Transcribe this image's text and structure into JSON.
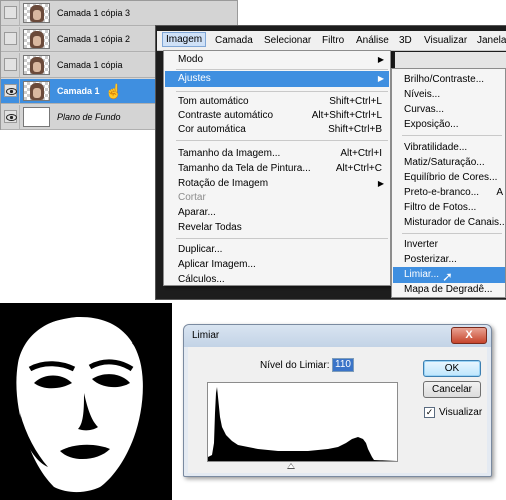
{
  "layers_panel": {
    "layers": [
      {
        "name": "Camada 1 cópia 3",
        "visible": false,
        "selected": false
      },
      {
        "name": "Camada 1 cópia 2",
        "visible": false,
        "selected": false
      },
      {
        "name": "Camada 1 cópia",
        "visible": false,
        "selected": false
      },
      {
        "name": "Camada 1",
        "visible": true,
        "selected": true
      },
      {
        "name": "Plano de Fundo",
        "visible": true,
        "selected": false
      }
    ]
  },
  "menubar": {
    "items": [
      "Imagem",
      "Camada",
      "Selecionar",
      "Filtro",
      "Análise",
      "3D",
      "Visualizar",
      "Janela"
    ],
    "active": "Imagem"
  },
  "image_menu": {
    "items": [
      {
        "label": "Modo",
        "shortcut": "",
        "submenu": true,
        "disabled": false
      },
      {
        "label": "Ajustes",
        "shortcut": "",
        "submenu": true,
        "disabled": false,
        "highlighted": true
      },
      {
        "label": "Tom automático",
        "shortcut": "Shift+Ctrl+L"
      },
      {
        "label": "Contraste automático",
        "shortcut": "Alt+Shift+Ctrl+L"
      },
      {
        "label": "Cor automática",
        "shortcut": "Shift+Ctrl+B"
      },
      {
        "label": "Tamanho da Imagem...",
        "shortcut": "Alt+Ctrl+I"
      },
      {
        "label": "Tamanho da Tela de Pintura...",
        "shortcut": "Alt+Ctrl+C"
      },
      {
        "label": "Rotação de Imagem",
        "shortcut": "",
        "submenu": true
      },
      {
        "label": "Cortar",
        "shortcut": "",
        "disabled": true
      },
      {
        "label": "Aparar...",
        "shortcut": ""
      },
      {
        "label": "Revelar Todas",
        "shortcut": ""
      },
      {
        "label": "Duplicar...",
        "shortcut": ""
      },
      {
        "label": "Aplicar Imagem...",
        "shortcut": ""
      },
      {
        "label": "Cálculos...",
        "shortcut": ""
      }
    ]
  },
  "adjust_submenu": {
    "items": [
      "Brilho/Contraste...",
      "Níveis...",
      "Curvas...",
      "Exposição...",
      "Vibratilidade...",
      "Matiz/Saturação...",
      "Equilíbrio de Cores...",
      "Preto-e-branco...",
      "Filtro de Fotos...",
      "Misturador de Canais...",
      "Inverter",
      "Posterizar...",
      "Limiar...",
      "Mapa de Degradê..."
    ],
    "shortcut_partial": "A",
    "highlighted": "Limiar..."
  },
  "dialog": {
    "title": "Limiar",
    "level_label": "Nível do Limiar:",
    "level_value": "110",
    "ok_label": "OK",
    "cancel_label": "Cancelar",
    "preview_label": "Visualizar",
    "preview_checked": true,
    "close_glyph": "X"
  },
  "colors": {
    "selection": "#3f8fe0",
    "menu_bg": "#f5f5f5",
    "dialog_bg": "#f0f0f0",
    "close_red": "#c6442b"
  }
}
